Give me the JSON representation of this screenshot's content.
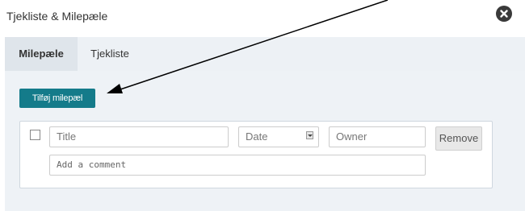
{
  "window": {
    "title": "Tjekliste & Milepæle",
    "close_icon": "close-icon"
  },
  "tabs": [
    {
      "label": "Milepæle",
      "active": true
    },
    {
      "label": "Tjekliste",
      "active": false
    }
  ],
  "panel": {
    "add_button_label": "Tilføj milepæl",
    "milestone": {
      "title_placeholder": "Title",
      "date_placeholder": "Date",
      "owner_placeholder": "Owner",
      "comment_placeholder": "Add a comment",
      "remove_label": "Remove"
    }
  },
  "colors": {
    "accent": "#147b8a",
    "panel_bg": "#eef2f6",
    "tab_active_bg": "#dfe5eb"
  },
  "annotation": {
    "icon": "arrow-icon",
    "points_to": "add-milestone-button"
  }
}
